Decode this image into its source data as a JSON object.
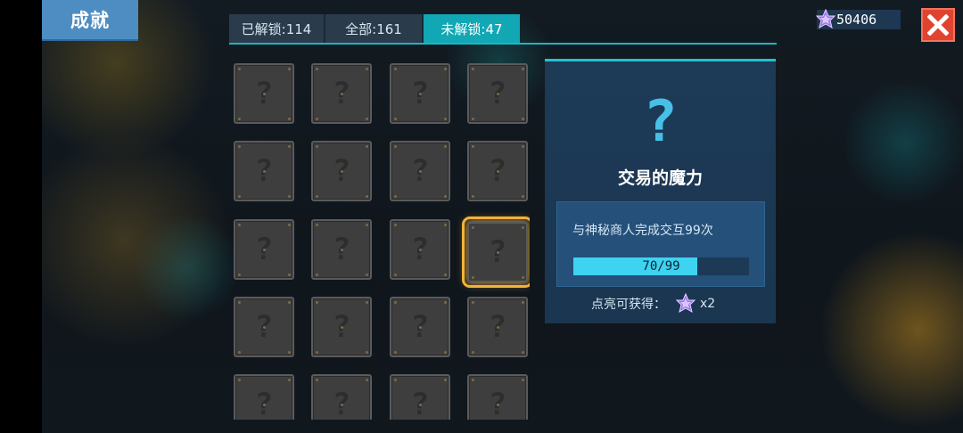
{
  "header": {
    "title": "成就",
    "currency_amount": "50406",
    "currency_icon": "star-gem-icon",
    "close_icon": "close-icon"
  },
  "tabs": [
    {
      "label": "已解锁:114",
      "active": false
    },
    {
      "label": "全部:161",
      "active": false
    },
    {
      "label": "未解锁:47",
      "active": true
    }
  ],
  "grid": {
    "tile_symbol": "?",
    "rows": [
      [
        "?",
        "?",
        "?",
        "?"
      ],
      [
        "?",
        "?",
        "?",
        "?"
      ],
      [
        "?",
        "?",
        "?",
        "?"
      ],
      [
        "?",
        "?",
        "?",
        "?"
      ],
      [
        "?",
        "?",
        "?",
        "?"
      ]
    ],
    "selected_row": 2,
    "selected_col": 3
  },
  "detail": {
    "icon": "question-mark-icon",
    "icon_symbol": "?",
    "name": "交易的魔力",
    "description": "与神秘商人完成交互99次",
    "progress_text": "70/99",
    "progress_fraction": 0.707,
    "reward_label": "点亮可获得：",
    "reward_icon": "star-gem-icon",
    "reward_multiplier": "x2"
  },
  "colors": {
    "accent": "#12a7b5",
    "title_tab": "#4d8dc2",
    "close": "#e0442e",
    "selection": "#f2b23b",
    "progress": "#3ed3f0"
  }
}
